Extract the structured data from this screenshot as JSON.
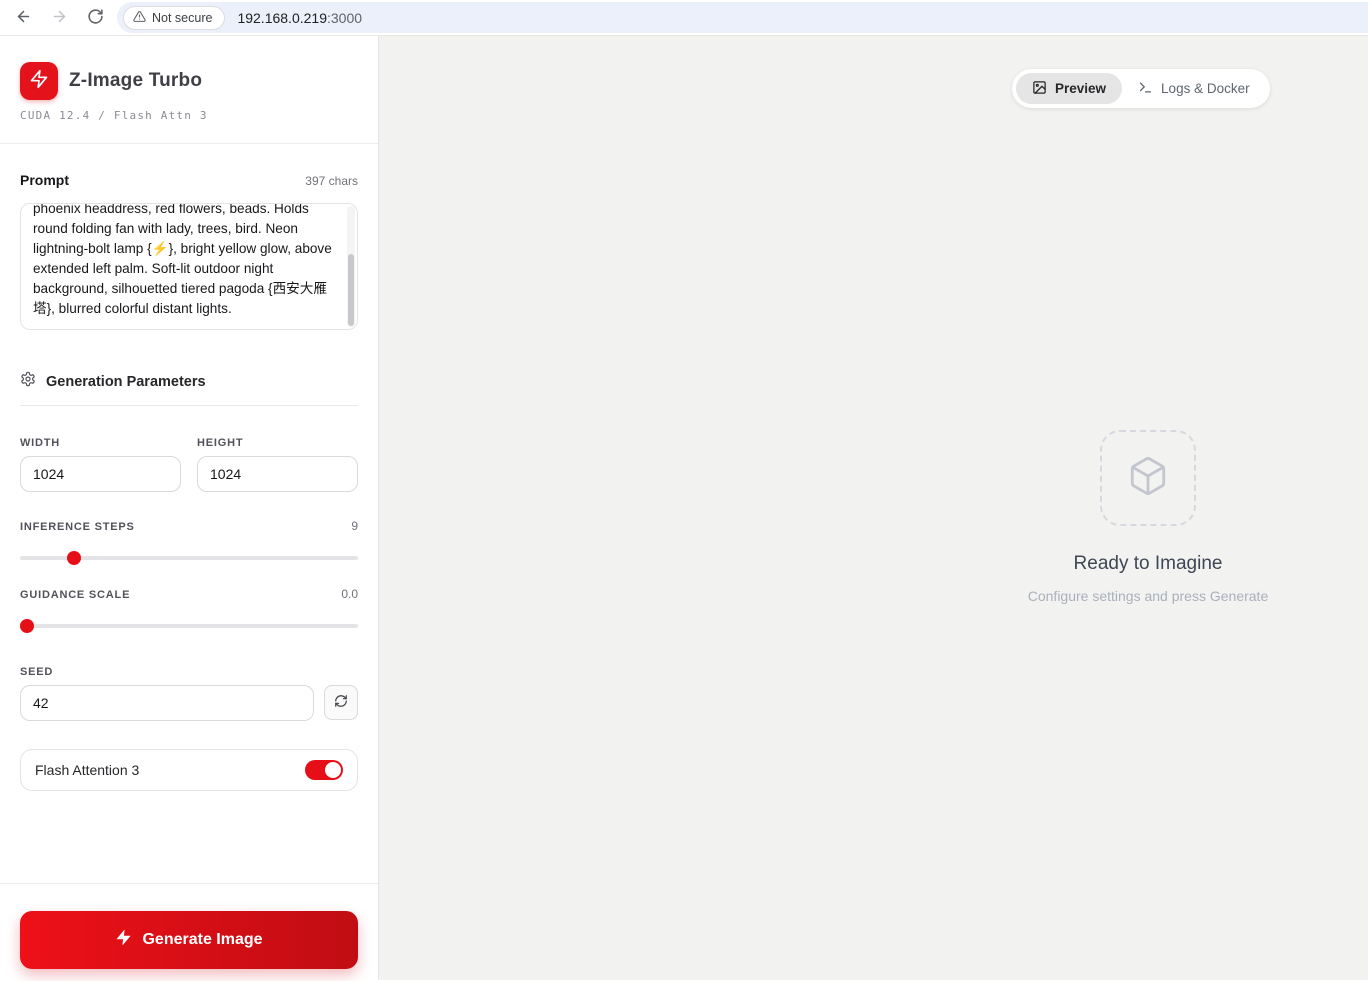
{
  "browser": {
    "security_badge": "Not secure",
    "url_host": "192.168.0.219",
    "url_port": ":3000"
  },
  "sidebar": {
    "app_title": "Z-Image Turbo",
    "app_subtitle": "CUDA 12.4 / Flash Attn 3",
    "prompt": {
      "label": "Prompt",
      "char_count": "397 chars",
      "visible_text": "phoenix headdress, red flowers, beads. Holds round folding fan with lady, trees, bird. Neon lightning-bolt lamp {⚡}, bright yellow glow, above extended left palm. Soft-lit outdoor night background, silhouetted tiered pagoda {西安大雁塔}, blurred colorful distant lights."
    },
    "parameters": {
      "section_title": "Generation Parameters",
      "width": {
        "label": "WIDTH",
        "value": "1024"
      },
      "height": {
        "label": "HEIGHT",
        "value": "1024"
      },
      "inference_steps": {
        "label": "INFERENCE STEPS",
        "value": "9",
        "percent": 16
      },
      "guidance_scale": {
        "label": "GUIDANCE SCALE",
        "value": "0.0",
        "percent": 0
      },
      "seed": {
        "label": "SEED",
        "value": "42"
      },
      "flash_attention": {
        "label": "Flash Attention 3",
        "enabled": true
      }
    },
    "generate_button_label": "Generate Image"
  },
  "main": {
    "tabs": [
      {
        "label": "Preview",
        "active": true
      },
      {
        "label": "Logs & Docker",
        "active": false
      }
    ],
    "empty_state": {
      "title": "Ready to Imagine",
      "subtitle": "Configure settings and press Generate"
    }
  },
  "icons": {
    "logo": "lightning-bolt",
    "section": "gear",
    "seed_button": "refresh-cycle",
    "preview_tab": "image",
    "logs_tab": "terminal",
    "empty_state": "box-cube",
    "security": "warning-triangle"
  },
  "colors": {
    "accent_red": "#e4121b",
    "toggle_on": "#e60f17",
    "slider_thumb": "#e60f17",
    "button_gradient": [
      "#ee1018",
      "#c00d13"
    ],
    "omnibox_bg": "#ecf0fa",
    "pane_bg": "#f2f2f1"
  }
}
